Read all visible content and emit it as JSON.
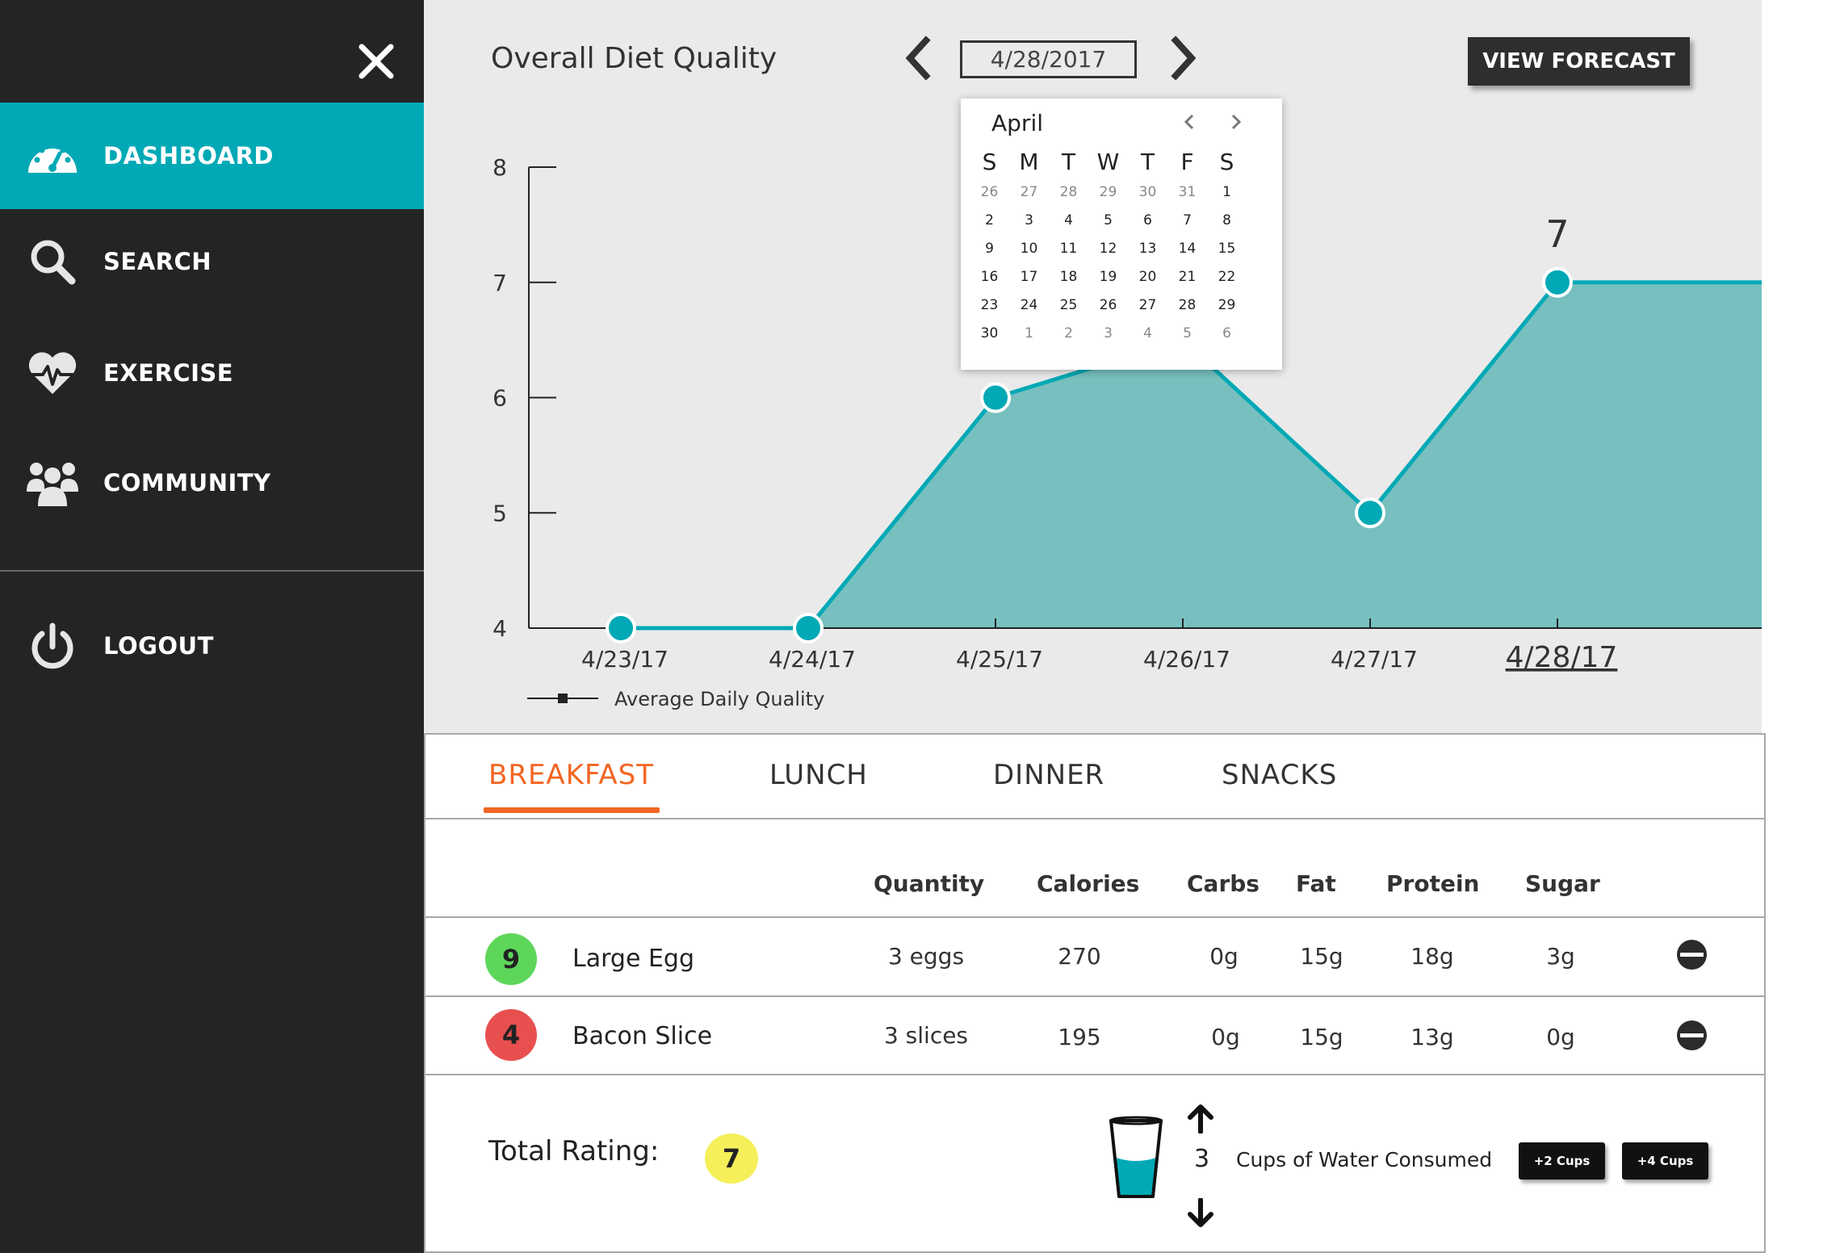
{
  "sidebar": {
    "items": [
      {
        "label": "DASHBOARD",
        "icon": "dashboard-gauge-icon",
        "active": true
      },
      {
        "label": "SEARCH",
        "icon": "search-icon",
        "active": false
      },
      {
        "label": "EXERCISE",
        "icon": "heartbeat-icon",
        "active": false
      },
      {
        "label": "COMMUNITY",
        "icon": "people-group-icon",
        "active": false
      }
    ],
    "logout_label": "LOGOUT",
    "close_icon": "close-icon"
  },
  "header": {
    "title": "Overall Diet Quality",
    "date_value": "4/28/2017",
    "forecast_button": "VIEW FORECAST"
  },
  "calendar": {
    "month": "April",
    "weekdays": [
      "S",
      "M",
      "T",
      "W",
      "T",
      "F",
      "S"
    ],
    "weeks": [
      [
        "26",
        "27",
        "28",
        "29",
        "30",
        "31",
        "1"
      ],
      [
        "2",
        "3",
        "4",
        "5",
        "6",
        "7",
        "8"
      ],
      [
        "9",
        "10",
        "11",
        "12",
        "13",
        "14",
        "15"
      ],
      [
        "16",
        "17",
        "18",
        "19",
        "20",
        "21",
        "22"
      ],
      [
        "23",
        "24",
        "25",
        "26",
        "27",
        "28",
        "29"
      ],
      [
        "30",
        "1",
        "2",
        "3",
        "4",
        "5",
        "6"
      ]
    ],
    "muted_first_week": 6,
    "muted_last_week_from": 1
  },
  "chart_data": {
    "type": "area",
    "categories": [
      "4/23/17",
      "4/24/17",
      "4/25/17",
      "4/26/17",
      "4/27/17",
      "4/28/17"
    ],
    "series": [
      {
        "name": "Average Daily Quality",
        "values": [
          4,
          4,
          6,
          6.5,
          5,
          7
        ]
      }
    ],
    "yticks": [
      "8",
      "7",
      "6",
      "5",
      "4"
    ],
    "ylim": [
      4,
      8
    ],
    "highlight_label": "7",
    "legend_label": "Average Daily Quality",
    "legend_position": "bottom-left",
    "colors": {
      "line": "#00a9b5",
      "fill": "#77c0bf"
    }
  },
  "meals": {
    "tabs": [
      "BREAKFAST",
      "LUNCH",
      "DINNER",
      "SNACKS"
    ],
    "active_tab": "BREAKFAST",
    "columns": [
      "Quantity",
      "Calories",
      "Carbs",
      "Fat",
      "Protein",
      "Sugar"
    ],
    "rows": [
      {
        "score": "9",
        "score_color": "#5dd65a",
        "name": "Large Egg",
        "quantity": "3 eggs",
        "calories": "270",
        "carbs": "0g",
        "fat": "15g",
        "protein": "18g",
        "sugar": "3g"
      },
      {
        "score": "4",
        "score_color": "#e85050",
        "name": "Bacon Slice",
        "quantity": "3 slices",
        "calories": "195",
        "carbs": "0g",
        "fat": "15g",
        "protein": "13g",
        "sugar": "0g"
      }
    ],
    "total_label": "Total Rating:",
    "total_value": "7",
    "water": {
      "count": "3",
      "label": "Cups of Water Consumed",
      "buttons": [
        "+2 Cups",
        "+4 Cups"
      ]
    }
  }
}
